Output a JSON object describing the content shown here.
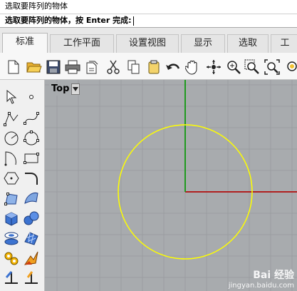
{
  "command": {
    "history": "选取要阵列的物体",
    "prompt": "选取要阵列的物体，按 Enter 完成:"
  },
  "tabs": [
    {
      "label": "标准",
      "active": true
    },
    {
      "label": "工作平面"
    },
    {
      "label": "设置视图"
    },
    {
      "label": "显示"
    },
    {
      "label": "选取"
    },
    {
      "label": "工"
    }
  ],
  "toolbar": {
    "icons": [
      "new-file-icon",
      "open-folder-icon",
      "save-icon",
      "print-icon",
      "import-icon",
      "cut-icon",
      "copy-icon",
      "paste-icon",
      "undo-icon",
      "pan-hand-icon",
      "rotate-view-icon",
      "zoom-icon",
      "zoom-window-icon",
      "zoom-extents-icon",
      "zoom-selected-icon"
    ]
  },
  "left_tools": {
    "icons": [
      "select-arrow-icon",
      "point-icon",
      "polyline-icon",
      "curve-icon",
      "circle-icon",
      "circle-3pt-icon",
      "arc-icon",
      "rectangle-icon",
      "polygon-icon",
      "fillet-curve-icon",
      "surface-corner-icon",
      "loft-icon",
      "box-solid-icon",
      "sphere-icon",
      "cylinder-icon",
      "mesh-icon",
      "gear-transform-icon",
      "boolean-icon",
      "dimension-icon",
      "snap-icon"
    ]
  },
  "viewport": {
    "name": "Top",
    "grid_color": "#9b9ea1",
    "x_axis_color": "#b02020",
    "y_axis_color": "#1e9a1e",
    "circle_color": "#ffff00"
  },
  "watermark": {
    "logo": "Bai 经验",
    "url": "jingyan.baidu.com"
  }
}
